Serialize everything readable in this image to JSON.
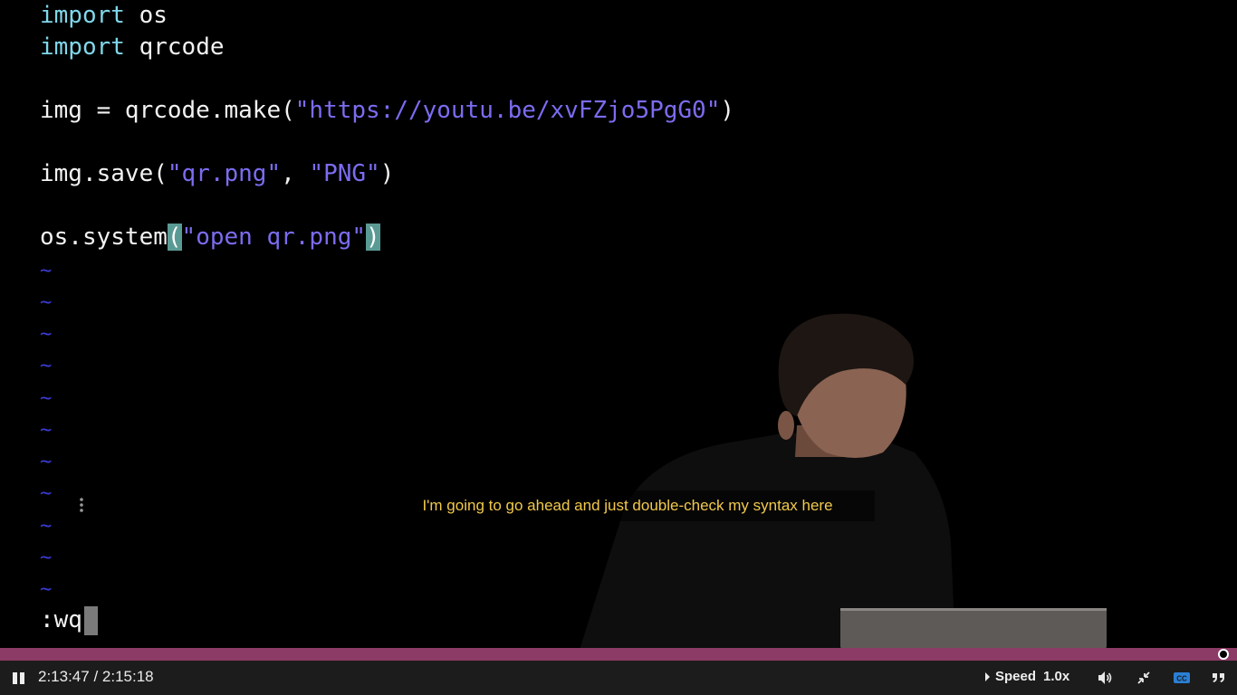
{
  "editor": {
    "lines": [
      {
        "kw": "import",
        "rest": " os"
      },
      {
        "kw": "import",
        "rest": " qrcode"
      },
      {
        "pre": "img = qrcode.make(",
        "str": "\"https://youtu.be/xvFZjo5PgG0\"",
        "post": ")"
      },
      {
        "pre": "img.save(",
        "str1": "\"qr.png\"",
        "mid": ", ",
        "str2": "\"PNG\"",
        "post": ")"
      },
      {
        "pre": "os.system",
        "open": "(",
        "str": "\"open qr.png\"",
        "close": ")"
      }
    ],
    "tilde": "~",
    "command": ":wq"
  },
  "caption": {
    "text": "I'm going to go ahead and just double-check my syntax here"
  },
  "player": {
    "current_time": "2:13:47",
    "separator": " / ",
    "duration": "2:15:18",
    "progress_fraction": 0.9888,
    "speed_label": "Speed",
    "speed_value": "1.0x",
    "colors": {
      "progress": "#8c3a66",
      "caption_text": "#f2c94c",
      "cc_active": "#2a7fd4"
    },
    "icons": [
      "pause-icon",
      "volume-icon",
      "exit-fullscreen-icon",
      "closed-captions-icon",
      "transcript-quote-icon",
      "caption-menu-icon"
    ]
  }
}
